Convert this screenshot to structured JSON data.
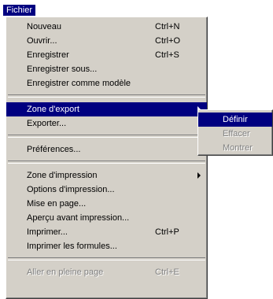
{
  "menubar": {
    "title": "Fichier"
  },
  "menu": {
    "group1": [
      {
        "label": "Nouveau",
        "shortcut": "Ctrl+N"
      },
      {
        "label": "Ouvrir...",
        "shortcut": "Ctrl+O"
      },
      {
        "label": "Enregistrer",
        "shortcut": "Ctrl+S"
      },
      {
        "label": "Enregistrer sous...",
        "shortcut": ""
      },
      {
        "label": "Enregistrer comme modèle",
        "shortcut": ""
      }
    ],
    "group2": [
      {
        "label": "Zone d'export",
        "shortcut": ""
      },
      {
        "label": "Exporter...",
        "shortcut": ""
      }
    ],
    "group3": [
      {
        "label": "Préférences...",
        "shortcut": ""
      }
    ],
    "group4": [
      {
        "label": "Zone d'impression",
        "shortcut": ""
      },
      {
        "label": "Options d'impression...",
        "shortcut": ""
      },
      {
        "label": "Mise en page...",
        "shortcut": ""
      },
      {
        "label": "Aperçu avant impression...",
        "shortcut": ""
      },
      {
        "label": "Imprimer...",
        "shortcut": "Ctrl+P"
      },
      {
        "label": "Imprimer les formules...",
        "shortcut": ""
      }
    ],
    "group5": [
      {
        "label": "Aller en pleine page",
        "shortcut": "Ctrl+E",
        "disabled": true
      }
    ]
  },
  "submenu": {
    "items": [
      {
        "label": "Définir"
      },
      {
        "label": "Effacer",
        "disabled": true
      },
      {
        "label": "Montrer",
        "disabled": true
      }
    ]
  },
  "colors": {
    "menu_background": "#d4d0c8",
    "highlight": "#000080",
    "disabled_text": "#808080"
  }
}
